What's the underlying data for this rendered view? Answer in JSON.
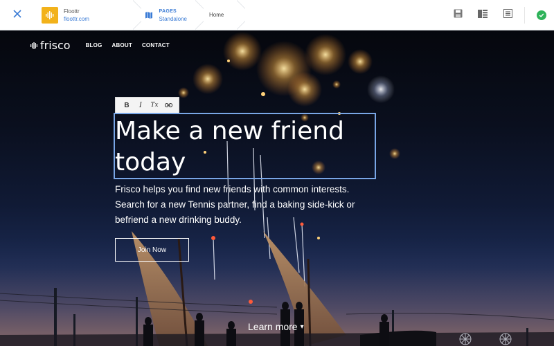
{
  "editor": {
    "site": {
      "name": "Floottr",
      "domain": "floottr.com"
    },
    "pages": {
      "label": "PAGES",
      "value": "Standalone"
    },
    "current_page": "Home",
    "icons": {
      "close": "close-icon",
      "save": "save-icon",
      "layout": "layout-icon",
      "form": "form-icon",
      "publish": "check-circle-icon"
    }
  },
  "site_header": {
    "brand": "frisco",
    "nav": [
      "BLOG",
      "ABOUT",
      "CONTACT"
    ]
  },
  "text_toolbar": {
    "bold": "B",
    "italic": "I",
    "clear_format": "Tx",
    "link_icon": "link-icon"
  },
  "hero": {
    "headline_line1": "Make a new friend",
    "headline_line2": "today",
    "subtext": "Frisco helps you find new friends with common interests. Search for a new Tennis partner, find a baking side-kick or befriend a new drinking buddy.",
    "cta": "Join Now",
    "learn_more": "Learn more",
    "learn_more_arrow": "▾"
  },
  "colors": {
    "accent_blue": "#3a7bd5",
    "selection_outline": "#79a6e6",
    "site_logo_bg": "#f2b21b",
    "publish_green": "#2fb35a"
  }
}
